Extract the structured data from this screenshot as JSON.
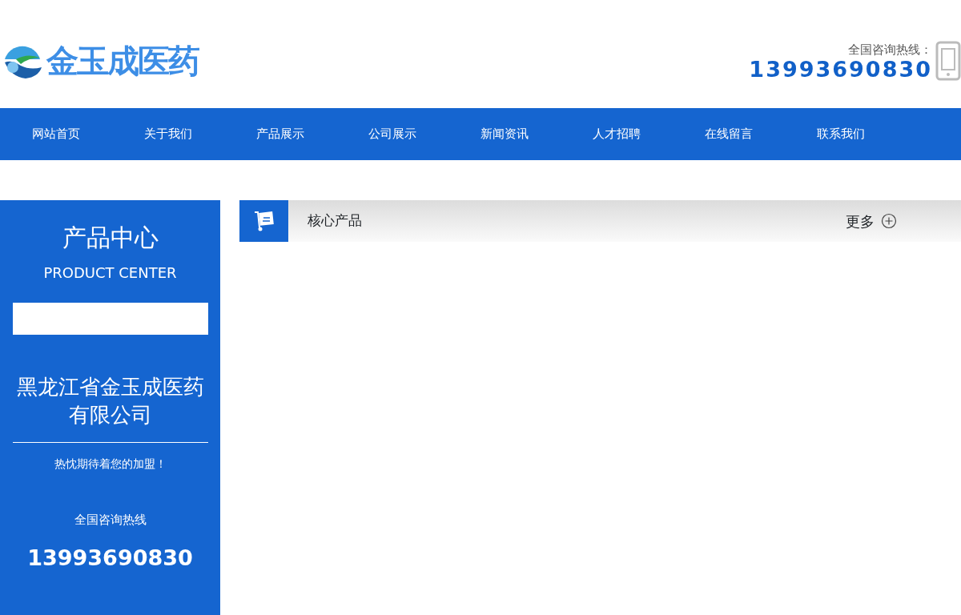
{
  "header": {
    "logo_text": "金玉成医药",
    "hotline_label": "全国咨询热线：",
    "hotline_number": "13993690830"
  },
  "nav": [
    {
      "label": "网站首页"
    },
    {
      "label": "关于我们"
    },
    {
      "label": "产品展示"
    },
    {
      "label": "公司展示"
    },
    {
      "label": "新闻资讯"
    },
    {
      "label": "人才招聘"
    },
    {
      "label": "在线留言"
    },
    {
      "label": "联系我们"
    }
  ],
  "sidebar": {
    "title": "产品中心",
    "subtitle": "PRODUCT CENTER",
    "company": "黑龙江省金玉成医药有限公司",
    "slogan": "热忱期待着您的加盟！",
    "hotline_label": "全国咨询热线",
    "hotline_number": "13993690830"
  },
  "section": {
    "title": "核心产品",
    "more": "更多"
  }
}
